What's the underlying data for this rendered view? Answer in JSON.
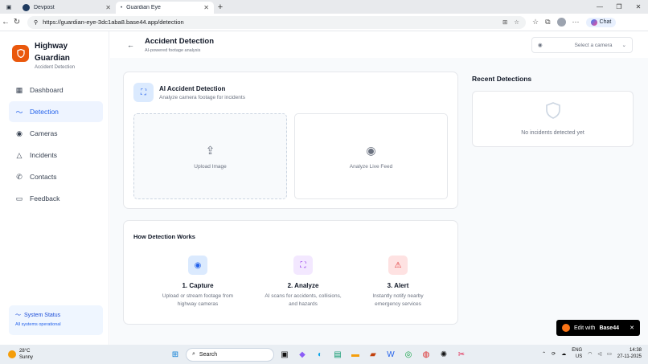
{
  "browser": {
    "tabs": [
      {
        "label": "Devpost",
        "icon": "devpost-icon"
      },
      {
        "label": "Guardian Eye",
        "icon": "page-dot-icon"
      }
    ],
    "url": "https://guardian-eye-3dc1aba8.base44.app/detection",
    "chat_label": "Chat"
  },
  "sidebar": {
    "brand_title_line1": "Highway",
    "brand_title_line2": "Guardian",
    "brand_sub": "Accident Detection",
    "items": [
      {
        "label": "Dashboard",
        "icon": "grid-icon",
        "active": false
      },
      {
        "label": "Detection",
        "icon": "activity-icon",
        "active": true
      },
      {
        "label": "Cameras",
        "icon": "camera-icon",
        "active": false
      },
      {
        "label": "Incidents",
        "icon": "warning-icon",
        "active": false
      },
      {
        "label": "Contacts",
        "icon": "phone-icon",
        "active": false
      },
      {
        "label": "Feedback",
        "icon": "message-icon",
        "active": false
      }
    ],
    "status_title": "System Status",
    "status_sub": "All systems operational"
  },
  "header": {
    "title": "Accident Detection",
    "subtitle": "AI-powered footage analysis",
    "camera_placeholder": "Select a camera"
  },
  "detection_card": {
    "title": "AI Accident Detection",
    "subtitle": "Analyze camera footage for incidents",
    "upload_label": "Upload Image",
    "live_label": "Analyze Live Feed"
  },
  "how_it_works": {
    "title": "How Detection Works",
    "steps": [
      {
        "title": "1. Capture",
        "line1": "Upload or stream footage from",
        "line2": "highway cameras",
        "color": "#dbeafe",
        "icon_color": "#2563eb"
      },
      {
        "title": "2. Analyze",
        "line1": "AI scans for accidents, collisions,",
        "line2": "and hazards",
        "color": "#f3e8ff",
        "icon_color": "#9333ea"
      },
      {
        "title": "3. Alert",
        "line1": "Instantly notify nearby",
        "line2": "emergency services",
        "color": "#fee2e2",
        "icon_color": "#dc2626"
      }
    ]
  },
  "recent": {
    "title": "Recent Detections",
    "empty": "No incidents detected yet"
  },
  "edit_badge": {
    "prefix": "Edit with",
    "brand": "Base44"
  },
  "taskbar": {
    "temp": "28°C",
    "condition": "Sunny",
    "search": "Search",
    "lang1": "ENG",
    "lang2": "US",
    "time": "14:38",
    "date": "27-11-2025"
  }
}
